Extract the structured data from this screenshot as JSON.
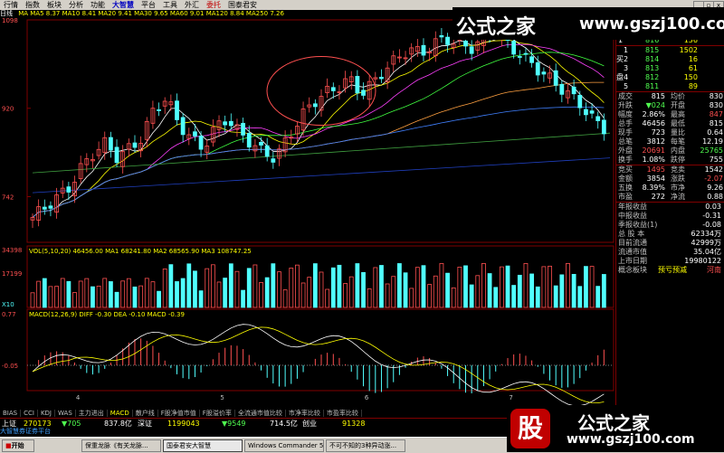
{
  "menu": {
    "items": [
      "行情",
      "指数",
      "板块",
      "分析",
      "功能",
      "大智慧",
      "平台",
      "工具",
      "外汇",
      "委托",
      "国泰君安"
    ],
    "active_index": 5,
    "red_index": 9
  },
  "window_controls": {
    "minimize": "_",
    "restore": "▫",
    "close": "x"
  },
  "infobar": {
    "label": "日线",
    "text": "MA MA5 8.37 MA10 8.41 MA20 9.41 MA30 9.65 MA60 9.01 MA120 8.84 MA250 7.26"
  },
  "price_axis": {
    "ticks": [
      "1098",
      "920",
      "742"
    ],
    "top_value": 10.98,
    "bottom_value": 6.5
  },
  "volume_panel": {
    "header": "VOL(5,10,20)  46456.00  MA1 68241.80  MA2 68565.90  MA3 108747.25",
    "ticks": [
      "34398",
      "17199",
      "X10"
    ]
  },
  "macd_panel": {
    "header": "MACD(12,26,9)  DIFF -0.30  DEA -0.10  MACD -0.39",
    "ticks": [
      "0.77",
      "-0.05"
    ]
  },
  "time_axis": {
    "labels": [
      "4",
      "5",
      "6",
      "7"
    ]
  },
  "quote": {
    "sell": [
      {
        "label": "3",
        "price": "818",
        "vol": "130"
      },
      {
        "label": "2",
        "price": "817",
        "vol": "197"
      },
      {
        "label": "1",
        "price": "816",
        "vol": "156"
      }
    ],
    "buy": [
      {
        "label": "1",
        "price": "815",
        "vol": "1502"
      },
      {
        "label": "2",
        "price": "814",
        "vol": "16"
      },
      {
        "label": "3",
        "price": "813",
        "vol": "61"
      },
      {
        "label": "4",
        "price": "812",
        "vol": "150"
      },
      {
        "label": "5",
        "price": "811",
        "vol": "89"
      }
    ],
    "sell_side_label": "盘",
    "buy_side_label": "买",
    "buy_side_label2": "盘",
    "stats": [
      {
        "k1": "成交",
        "v1": "815",
        "k2": "均价",
        "v2": "830"
      },
      {
        "k1": "升跌",
        "v1": "▼024",
        "k2": "开盘",
        "v2": "830"
      },
      {
        "k1": "幅度",
        "v1": "2.86%",
        "k2": "最高",
        "v2": "847"
      },
      {
        "k1": "总手",
        "v1": "46456",
        "k2": "最低",
        "v2": "815"
      },
      {
        "k1": "现手",
        "v1": "723",
        "k2": "量比",
        "v2": "0.64"
      },
      {
        "k1": "总笔",
        "v1": "3812",
        "k2": "每笔",
        "v2": "12.19"
      },
      {
        "k1": "外盘",
        "v1": "20691",
        "k2": "内盘",
        "v2": "25765"
      },
      {
        "k1": "换手",
        "v1": "1.08%",
        "k2": "跌停",
        "v2": "755"
      }
    ],
    "extra": [
      {
        "k1": "竞买",
        "v1": "1495",
        "k2": "竞卖",
        "v2": "1542"
      },
      {
        "k1": "金额",
        "v1": "3854",
        "k2": "涨跌",
        "v2": "-2.07"
      },
      {
        "k1": "五换",
        "v1": "8.39%",
        "k2": "市净",
        "v2": "9.26"
      },
      {
        "k1": "市盈",
        "v1": "272",
        "k2": "净流",
        "v2": "0.88"
      }
    ],
    "fund": [
      {
        "k": "年报收益",
        "v": "0.03"
      },
      {
        "k": "中报收益",
        "v": "-0.31"
      },
      {
        "k": "季报收益(1)",
        "v": "-0.08"
      },
      {
        "k": "总 股 本",
        "v": "62334万"
      },
      {
        "k": "目前流通",
        "v": "42999万"
      },
      {
        "k": "流通市值",
        "v": "35.04亿"
      },
      {
        "k": "上市日期",
        "v": "19980122"
      }
    ],
    "concept_label": "概念板块",
    "concept_value": "预亏预减",
    "concept_region": "河南"
  },
  "indicator_tabs": [
    "BIAS",
    "CCI",
    "KDJ",
    "WAS",
    "主力进出",
    "MACD",
    "散户线",
    "F股净值市值",
    "F股溢价率",
    "全流通市值比较",
    "市净率比较",
    "市盈率比较"
  ],
  "indicator_active": 5,
  "status": {
    "market": "上证",
    "index_value": "270173",
    "index_change": "▼705",
    "amount": "837.8亿",
    "exchange2": "深证",
    "index2_value": "1199043",
    "index2_change": "▼9549",
    "amount2": "714.5亿",
    "exchange3": "创业",
    "index3_value": "91328"
  },
  "ticker": "大智慧券证券平台",
  "taskbar": {
    "start": "开始",
    "tasks": [
      "保重龙脉《有关龙脉...",
      "国泰君安大智慧",
      "Windows Commander 5...",
      "不可不知的3种异动涨..."
    ]
  },
  "watermark": {
    "top_text": "公式之家",
    "top_url": "www.gszj100.com",
    "bottom_logo": "股",
    "bottom_text": "公式之家",
    "bottom_url": "www.gszj100.com"
  },
  "colors": {
    "up": "#ff5050",
    "down": "#50ffff",
    "border": "#800000",
    "accent": "#ffff00"
  }
}
